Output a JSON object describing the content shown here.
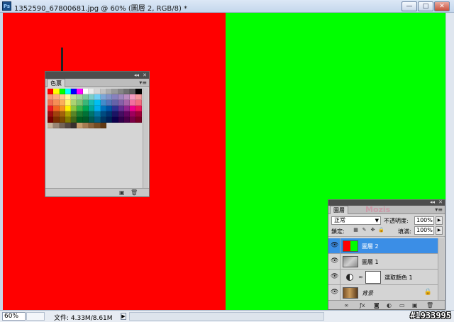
{
  "window": {
    "title": "1352590_67800681.jpg @ 60% (圖層 2, RGB/8) *",
    "app_icon": "Ps",
    "buttons": {
      "minimize": "—",
      "maximize": "□",
      "close": "✕"
    }
  },
  "canvas": {
    "left_color": "#ff0000",
    "right_color": "#00ff00"
  },
  "swatches_panel": {
    "tab_label": "色票",
    "rows": [
      [
        "#ff0000",
        "#ffff00",
        "#00ff00",
        "#00ffff",
        "#0000ff",
        "#ff00ff",
        "#ffffff",
        "#ebebeb",
        "#d6d6d6",
        "#c2c2c2",
        "#adadad",
        "#999999",
        "#858585",
        "#707070",
        "#5c5c5c",
        "#000000"
      ],
      [
        "#f7977a",
        "#fbad82",
        "#fdc68c",
        "#fff799",
        "#c6df9c",
        "#a4d49d",
        "#81ca9d",
        "#7bcdc9",
        "#6ccff7",
        "#7ca6d8",
        "#8293ca",
        "#8881be",
        "#a286bd",
        "#bc8cbf",
        "#f49bc1",
        "#f5999d"
      ],
      [
        "#f26c4f",
        "#f68e56",
        "#fbaf5a",
        "#fff467",
        "#acd372",
        "#7dc473",
        "#39b778",
        "#16bcb4",
        "#00bff3",
        "#438ccb",
        "#5574b9",
        "#6562a8",
        "#8560a8",
        "#a863a8",
        "#f26e9f",
        "#f26c7e"
      ],
      [
        "#ed1c24",
        "#f26522",
        "#f7941d",
        "#fff200",
        "#8dc63f",
        "#39b54a",
        "#00a651",
        "#00a99d",
        "#00aeef",
        "#0072bc",
        "#0054a6",
        "#2e3192",
        "#662d91",
        "#92278f",
        "#ec008c",
        "#ed145b"
      ],
      [
        "#9e0b0f",
        "#a0410d",
        "#a3620a",
        "#aba000",
        "#598527",
        "#1a7b30",
        "#007236",
        "#00746b",
        "#0076a3",
        "#004b80",
        "#003471",
        "#1b1464",
        "#440e62",
        "#630460",
        "#9e005d",
        "#9e0039"
      ],
      [
        "#790000",
        "#7b2e00",
        "#7d4900",
        "#827b00",
        "#406618",
        "#005e20",
        "#005826",
        "#005952",
        "#005b7f",
        "#003663",
        "#002157",
        "#0d004c",
        "#32004b",
        "#4b0049",
        "#7b0046",
        "#7a0026"
      ],
      [
        "#c7b299",
        "#998675",
        "#736357",
        "#534741",
        "#37302d",
        "#c69c6d",
        "#a67c52",
        "#8c6239",
        "#754c24",
        "#603913"
      ]
    ]
  },
  "layers_panel": {
    "tab_label": "圖層",
    "blend_mode": "正常",
    "opacity_label": "不透明度:",
    "opacity_value": "100%",
    "lock_label": "鎖定:",
    "fill_label": "填滿:",
    "fill_value": "100%",
    "watermark": "Mozis",
    "layers": [
      {
        "name": "圖層 2",
        "active": true
      },
      {
        "name": "圖層 1",
        "active": false
      },
      {
        "name": "選取顏色 1",
        "active": false
      },
      {
        "name": "背景",
        "active": false
      }
    ]
  },
  "statusbar": {
    "zoom": "60%",
    "doc_info": "文件: 4.33M/8.61M",
    "watermark": "#1933995"
  }
}
